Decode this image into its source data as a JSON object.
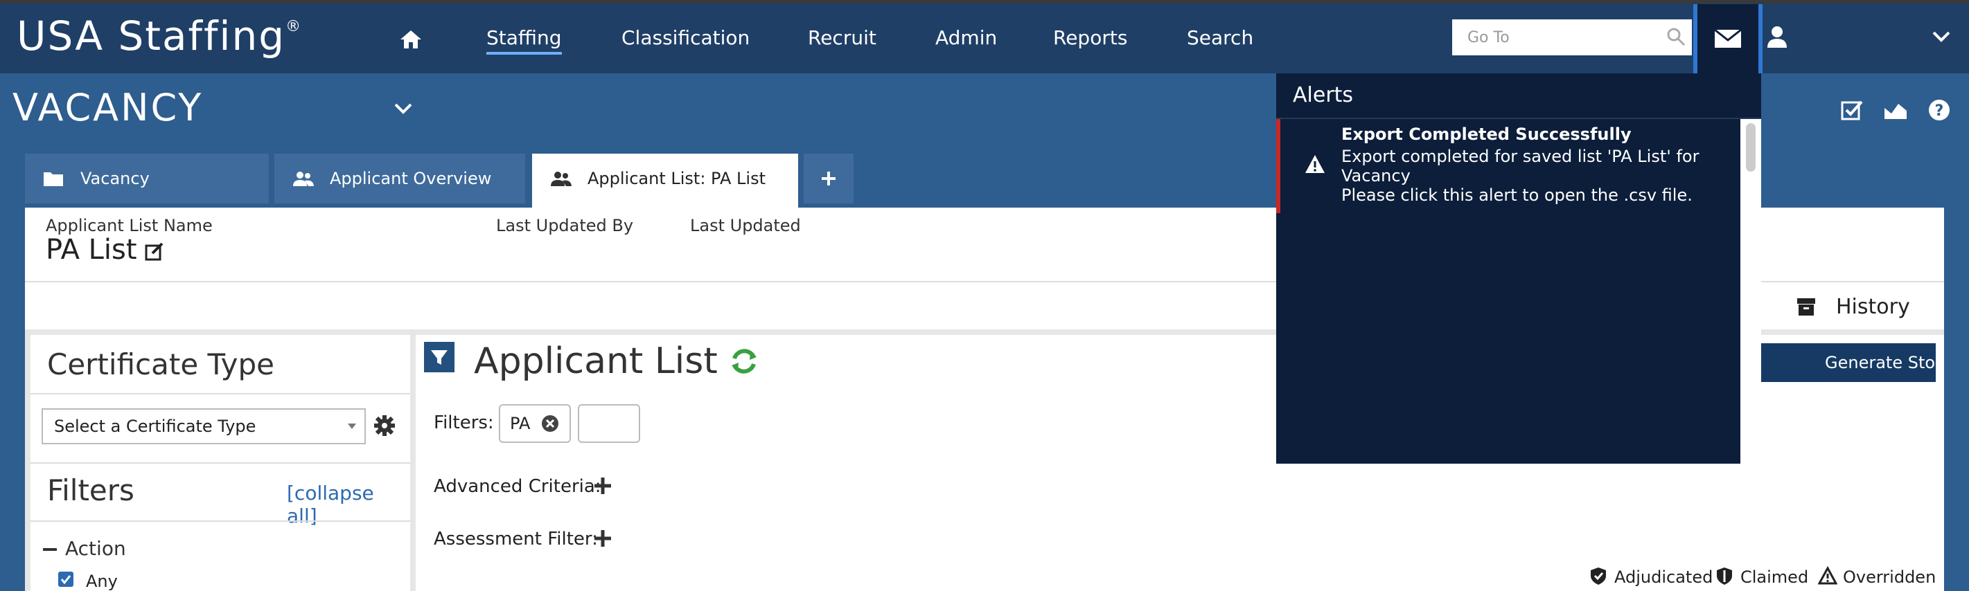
{
  "app": {
    "logo_text": "USA Staffing",
    "logo_mark": "®"
  },
  "nav": {
    "items": [
      {
        "label": "Staffing",
        "active": true
      },
      {
        "label": "Classification"
      },
      {
        "label": "Recruit"
      },
      {
        "label": "Admin"
      },
      {
        "label": "Reports"
      },
      {
        "label": "Search"
      }
    ],
    "goto_placeholder": "Go To"
  },
  "vacancy": {
    "title": "VACANCY"
  },
  "tabs": [
    {
      "label": "Vacancy",
      "icon": "folder-icon"
    },
    {
      "label": "Applicant Overview",
      "icon": "users-icon"
    },
    {
      "label": "Applicant List: PA List",
      "icon": "users-icon",
      "active": true
    }
  ],
  "list_header": {
    "name_label": "Applicant List Name",
    "name_value": "PA List",
    "last_updated_by_label": "Last Updated By",
    "last_updated_label": "Last Updated"
  },
  "toolbar": {
    "history_label": "History"
  },
  "left_panel": {
    "certificate_title": "Certificate Type",
    "certificate_select_value": "Select a Certificate Type",
    "filters_title": "Filters",
    "collapse_all": "[collapse all]",
    "action_label": "Action",
    "any_label": "Any"
  },
  "main": {
    "title": "Applicant List",
    "generate_button": "Generate Stored list",
    "filters_label": "Filters:",
    "chip_label": "PA",
    "advanced_criteria_label": "Advanced Criteria:",
    "assessment_filter_label": "Assessment Filter:",
    "legend": [
      "Adjudicated",
      "Claimed",
      "Overridden"
    ]
  },
  "alerts": {
    "title": "Alerts",
    "items": [
      {
        "title": "Export Completed Successfully",
        "lines": [
          "Export completed for saved list 'PA List' for",
          "Vacancy",
          "Please click this alert to open the .csv file."
        ]
      }
    ]
  },
  "colors": {
    "topbar": "#1f3f66",
    "page": "#2e5d8f",
    "alerts_bg": "#0c1e3a",
    "alert_accent": "#c62828",
    "refresh": "#3aa040",
    "primary_button": "#163a64"
  }
}
